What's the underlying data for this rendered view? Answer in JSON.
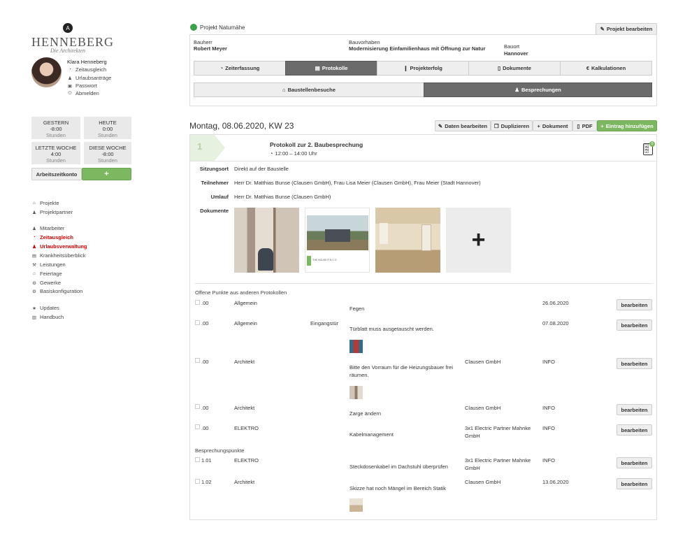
{
  "brand": {
    "mark": "A",
    "name": "HENNEBERG",
    "sub": "Die Architekten"
  },
  "user": {
    "name": "Klara Henneberg",
    "menu": [
      {
        "icon": "clock-icon",
        "glyph": "◔",
        "label": "Zeitausgleich"
      },
      {
        "icon": "people-icon",
        "glyph": "♟",
        "label": "Urlaubsanträge"
      },
      {
        "icon": "lock-icon",
        "glyph": "▣",
        "label": "Passwort"
      },
      {
        "icon": "power-icon",
        "glyph": "⏻",
        "label": "Abmelden"
      }
    ]
  },
  "stats": [
    {
      "title": "GESTERN",
      "value": "-8:00",
      "unit": "Stunden"
    },
    {
      "title": "HEUTE",
      "value": "0:00",
      "unit": "Stunden"
    },
    {
      "title": "LETZTE WOCHE",
      "value": "4:00",
      "unit": "Stunden"
    },
    {
      "title": "DIESE WOCHE",
      "value": "-8:00",
      "unit": "Stunden"
    }
  ],
  "account": {
    "label": "Arbeitszeitkonto",
    "add": "+"
  },
  "nav": [
    {
      "label": "Projekte",
      "glyph": "⌂",
      "icon": "home-icon"
    },
    {
      "label": "Projektpartner",
      "glyph": "♟",
      "icon": "people-icon"
    },
    {
      "label": "Mitarbeiter",
      "glyph": "♟",
      "icon": "team-icon"
    },
    {
      "label": "Zeitausgleich",
      "glyph": "◔",
      "icon": "clock-icon",
      "active": true
    },
    {
      "label": "Urlaubsverwaltung",
      "glyph": "♟",
      "icon": "vacation-icon",
      "active": true
    },
    {
      "label": "Krankheitsüberblick",
      "glyph": "▤",
      "icon": "list-icon"
    },
    {
      "label": "Leistungen",
      "glyph": "⚒",
      "icon": "wrench-icon"
    },
    {
      "label": "Feiertage",
      "glyph": "⌂",
      "icon": "calendar-icon"
    },
    {
      "label": "Gewerke",
      "glyph": "⚙",
      "icon": "gears-icon"
    },
    {
      "label": "Basiskonfiguration",
      "glyph": "⚙",
      "icon": "gear-icon"
    },
    {
      "label": "Updates",
      "glyph": "★",
      "icon": "star-icon"
    },
    {
      "label": "Handbuch",
      "glyph": "▥",
      "icon": "book-icon"
    }
  ],
  "project": {
    "name": "Projekt Naturnähe",
    "status_color": "#3aa14a",
    "edit": "Projekt bearbeiten",
    "bauherr_label": "Bauherr",
    "bauherr": "Robert Meyer",
    "vorhaben_label": "Bauvorhaben",
    "vorhaben": "Modernisierung Einfamilienhaus mit Öffnung zur Natur",
    "ort_label": "Bauort",
    "ort": "Hannover"
  },
  "tabs": [
    {
      "label": "Zeiterfassung",
      "glyph": "◔"
    },
    {
      "label": "Protokolle",
      "glyph": "▤",
      "active": true
    },
    {
      "label": "Projekterfolg",
      "glyph": "❙",
      "active": false
    },
    {
      "label": "Dokumente",
      "glyph": "▯"
    },
    {
      "label": "Kalkulationen",
      "glyph": "€"
    }
  ],
  "subtabs": [
    {
      "label": "Baustellenbesuche",
      "glyph": "⌂"
    },
    {
      "label": "Besprechungen",
      "glyph": "♟",
      "active": true
    }
  ],
  "day": {
    "heading": "Montag, 08.06.2020, KW 23",
    "actions": [
      "Daten bearbeiten",
      "Duplizieren",
      "Dokument",
      "PDF"
    ],
    "add": "Eintrag hinzufügen"
  },
  "meeting": {
    "number": "1",
    "title": "Protokoll zur 2. Baubesprechung",
    "time": "12:00 – 14:00 Uhr",
    "badge": "0",
    "ort_label": "Sitzungsort",
    "ort": "Direkt auf der Baustelle",
    "teil_label": "Teilnehmer",
    "teil": "Herr Dr. Matthias Bunse (Clausen GmbH), Frau Lisa Meier (Clausen GmbH), Frau Meier (Stadt Hannover)",
    "umlauf_label": "Umlauf",
    "umlauf": "Herr Dr. Matthias Bunse (Clausen GmbH)",
    "docs_label": "Dokumente",
    "doc_add": "+",
    "doc_caption": "THE HOUSE R N C O"
  },
  "open_title": "Offene Punkte aus anderen Protokollen",
  "open": [
    {
      "nr": ".00",
      "cat": "Allgemein",
      "sub": "",
      "text": "Fegen",
      "who": "",
      "date": "26.06.2020",
      "btn": "bearbeiten"
    },
    {
      "nr": ".00",
      "cat": "Allgemein",
      "sub": "Eingangstür",
      "text": "Türblatt muss ausgetauscht werden.",
      "who": "",
      "date": "07.08.2020",
      "btn": "bearbeiten"
    },
    {
      "nr": ".00",
      "cat": "Architekt",
      "sub": "",
      "text": "Bitte den Vorraum für die Heizungsbauer frei räumen.",
      "who": "Clausen GmbH",
      "date": "INFO",
      "btn": "bearbeiten"
    },
    {
      "nr": ".00",
      "cat": "Architekt",
      "sub": "",
      "text": "Zarge ändern",
      "who": "Clausen GmbH",
      "date": "INFO",
      "btn": "bearbeiten"
    },
    {
      "nr": ".00",
      "cat": "ELEKTRO",
      "sub": "",
      "text": "Kabelmanagement",
      "who": "3x1 Electric Partner Mahnke GmbH",
      "date": "INFO",
      "btn": "bearbeiten"
    }
  ],
  "points_title": "Besprechungspunkte",
  "points": [
    {
      "nr": "1.01",
      "cat": "ELEKTRO",
      "text": "Steckdosenkabel im Dachstuhl überprüfen",
      "who": "3x1 Electric Partner Mahnke GmbH",
      "date": "INFO",
      "btn": "bearbeiten"
    },
    {
      "nr": "1.02",
      "cat": "Architekt",
      "text": "Skizze hat noch Mängel im Bereich Statik",
      "who": "Clausen GmbH",
      "date": "13.06.2020",
      "btn": "bearbeiten"
    }
  ],
  "colors": {
    "green": "#7cb860",
    "active_tab": "#6b6b6b",
    "red": "#d00000"
  }
}
